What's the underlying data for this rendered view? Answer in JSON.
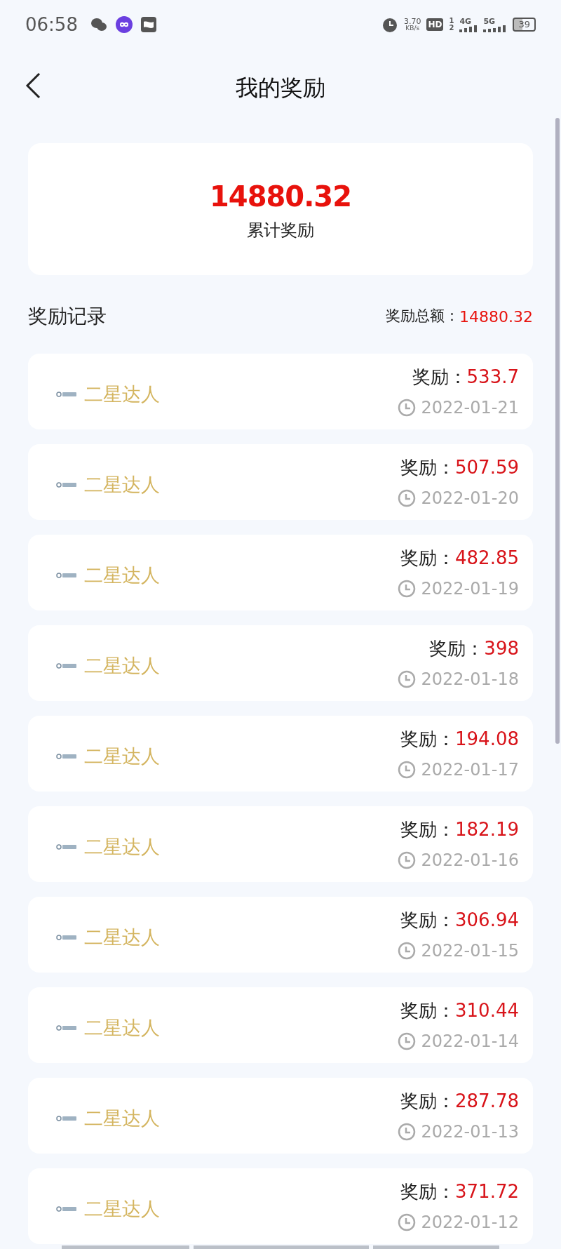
{
  "status_bar": {
    "time": "06:58",
    "speed_value": "3.70",
    "speed_unit": "KB/s",
    "hd": "HD",
    "sim_1": "1",
    "sim_2": "2",
    "network_1": "4G",
    "network_2": "5G",
    "battery": "39"
  },
  "header": {
    "title": "我的奖励"
  },
  "summary": {
    "amount": "14880.32",
    "label": "累计奖励"
  },
  "section": {
    "title": "奖励记录",
    "total_label": "奖励总额：",
    "total_value": "14880.32"
  },
  "records": [
    {
      "level": "二星达人",
      "reward_label": "奖励：",
      "reward": "533.7",
      "date": "2022-01-21"
    },
    {
      "level": "二星达人",
      "reward_label": "奖励：",
      "reward": "507.59",
      "date": "2022-01-20"
    },
    {
      "level": "二星达人",
      "reward_label": "奖励：",
      "reward": "482.85",
      "date": "2022-01-19"
    },
    {
      "level": "二星达人",
      "reward_label": "奖励：",
      "reward": "398",
      "date": "2022-01-18"
    },
    {
      "level": "二星达人",
      "reward_label": "奖励：",
      "reward": "194.08",
      "date": "2022-01-17"
    },
    {
      "level": "二星达人",
      "reward_label": "奖励：",
      "reward": "182.19",
      "date": "2022-01-16"
    },
    {
      "level": "二星达人",
      "reward_label": "奖励：",
      "reward": "306.94",
      "date": "2022-01-15"
    },
    {
      "level": "二星达人",
      "reward_label": "奖励：",
      "reward": "310.44",
      "date": "2022-01-14"
    },
    {
      "level": "二星达人",
      "reward_label": "奖励：",
      "reward": "287.78",
      "date": "2022-01-13"
    },
    {
      "level": "二星达人",
      "reward_label": "奖励：",
      "reward": "371.72",
      "date": "2022-01-12"
    }
  ]
}
